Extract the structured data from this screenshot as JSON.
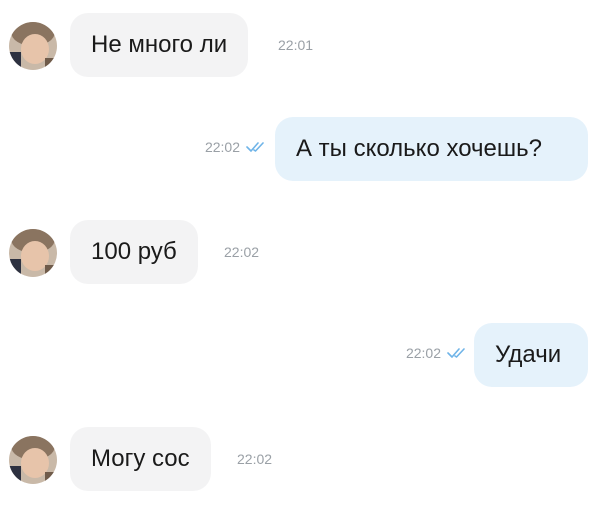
{
  "messages": [
    {
      "direction": "in",
      "text": "Не много ли",
      "time": "22:01"
    },
    {
      "direction": "out",
      "text": "А ты сколько хочешь?",
      "time": "22:02",
      "status_icon": "double-check-icon"
    },
    {
      "direction": "in",
      "text": "100 руб",
      "time": "22:02"
    },
    {
      "direction": "out",
      "text": "Удачи",
      "time": "22:02",
      "status_icon": "double-check-icon"
    },
    {
      "direction": "in",
      "text": "Могу сос",
      "time": "22:02"
    }
  ],
  "colors": {
    "incoming_bubble": "#f3f3f4",
    "outgoing_bubble": "#e5f2fb",
    "timestamp": "#9aa0a6",
    "read_check": "#6fb4e8"
  }
}
